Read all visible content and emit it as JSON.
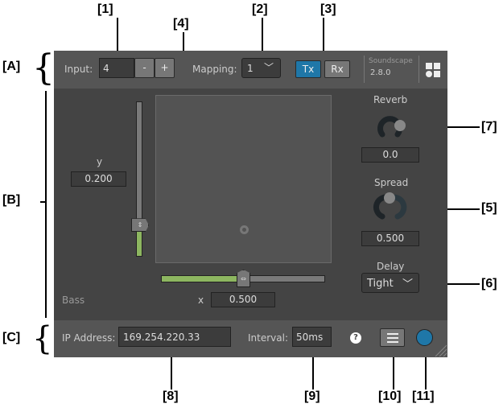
{
  "annotations": {
    "A": "[A]",
    "B": "[B]",
    "C": "[C]",
    "n1": "[1]",
    "n2": "[2]",
    "n3": "[3]",
    "n4": "[4]",
    "n5": "[5]",
    "n6": "[6]",
    "n7": "[7]",
    "n8": "[8]",
    "n9": "[9]",
    "n10": "[10]",
    "n11": "[11]"
  },
  "header": {
    "input_label": "Input:",
    "input_value": "4",
    "minus": "-",
    "plus": "+",
    "mapping_label": "Mapping:",
    "mapping_value": "1",
    "tx": "Tx",
    "rx": "Rx",
    "app_name": "Soundscape",
    "version": "2.8.0",
    "accent": "#1f77a8"
  },
  "main": {
    "y_label": "y",
    "y_value": "0.200",
    "x_label": "x",
    "x_value": "0.500",
    "channel_label": "Bass",
    "reverb_label": "Reverb",
    "reverb_value": "0.0",
    "spread_label": "Spread",
    "spread_value": "0.500",
    "delay_label": "Delay",
    "delay_value": "Tight",
    "slider_color": "#8db660"
  },
  "footer": {
    "ip_label": "IP Address:",
    "ip_value": "169.254.220.33",
    "interval_label": "Interval:",
    "interval_value": "50",
    "interval_unit": "ms",
    "help": "?"
  }
}
